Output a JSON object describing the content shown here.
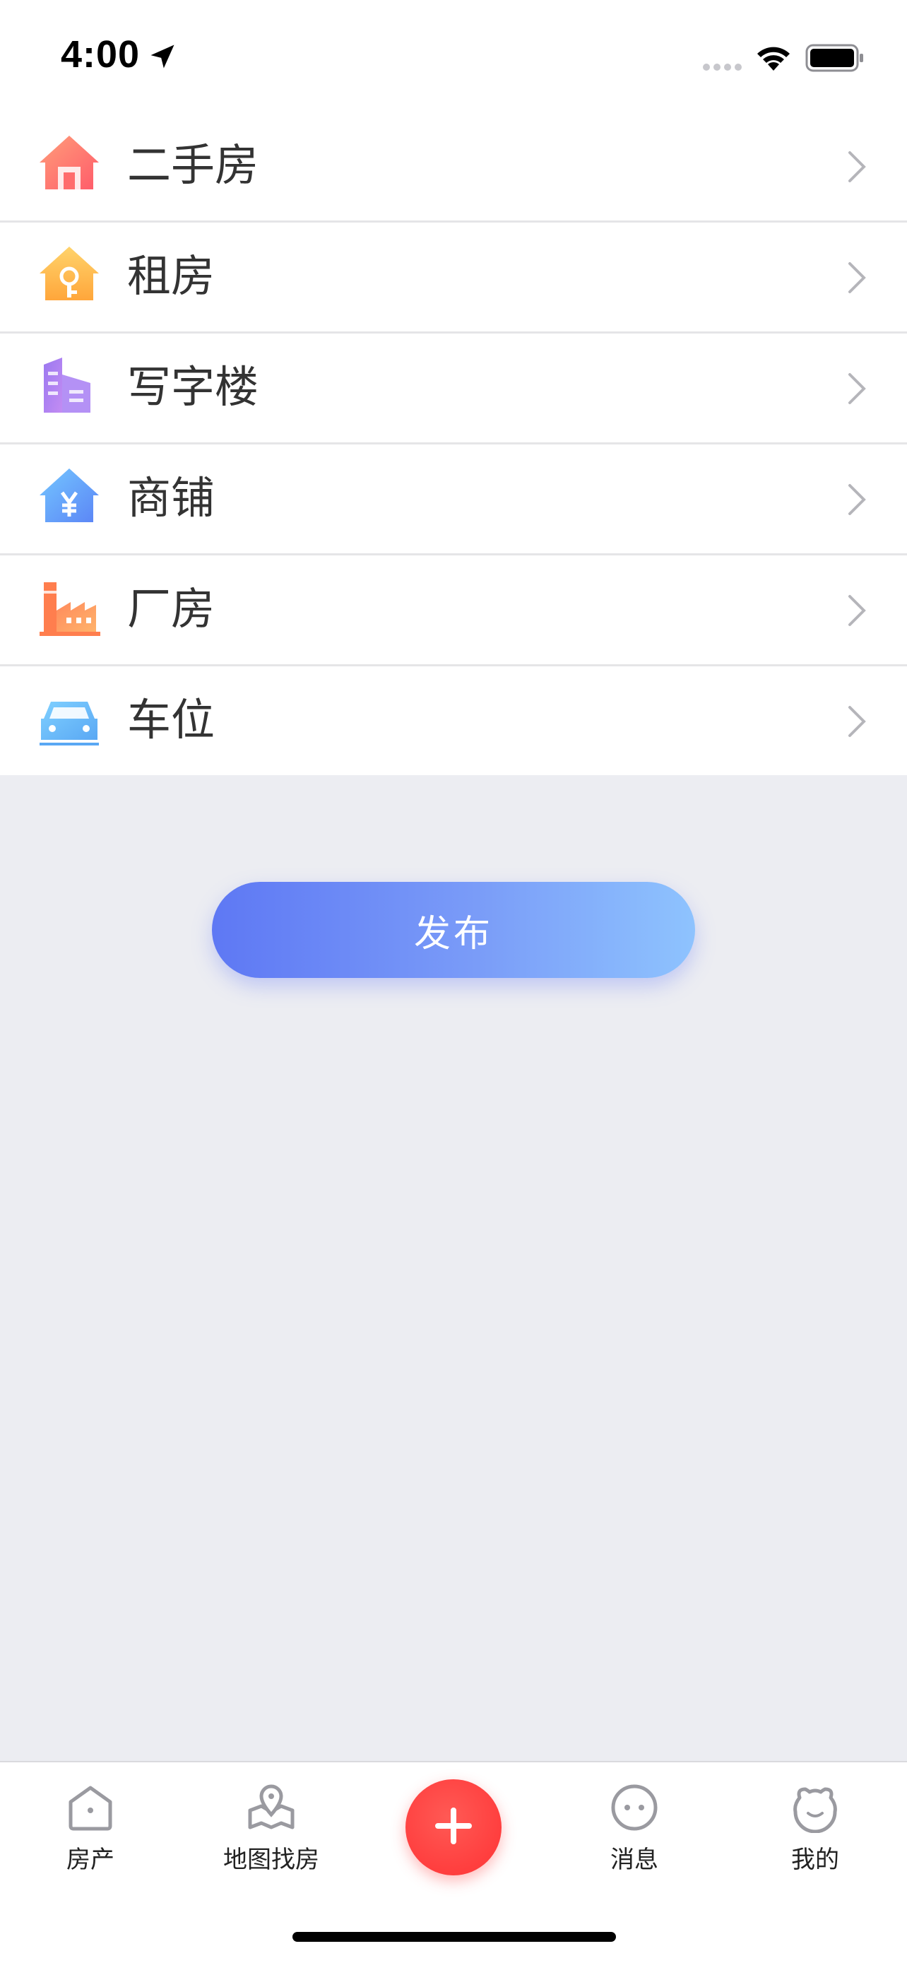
{
  "status_bar": {
    "time": "4:00"
  },
  "menu": {
    "items": [
      {
        "label": "二手房",
        "icon": "house-icon"
      },
      {
        "label": "租房",
        "icon": "house-key-icon"
      },
      {
        "label": "写字楼",
        "icon": "office-building-icon"
      },
      {
        "label": "商铺",
        "icon": "shop-yuan-icon"
      },
      {
        "label": "厂房",
        "icon": "factory-icon"
      },
      {
        "label": "车位",
        "icon": "car-icon"
      }
    ]
  },
  "publish_button": {
    "label": "发布"
  },
  "tab_bar": {
    "tabs": [
      {
        "label": "房产",
        "icon": "home-tab-icon"
      },
      {
        "label": "地图找房",
        "icon": "map-pin-icon"
      },
      {
        "label": "",
        "icon": "plus-icon"
      },
      {
        "label": "消息",
        "icon": "message-face-icon"
      },
      {
        "label": "我的",
        "icon": "profile-face-icon"
      }
    ]
  },
  "colors": {
    "accent_blue_start": "#5E78F4",
    "accent_blue_end": "#8EC3FE",
    "add_button_red": "#FF3E3E",
    "page_background": "#ECEDF2"
  }
}
